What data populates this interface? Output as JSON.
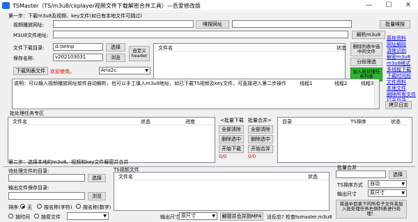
{
  "window": {
    "title": "TSMaster（TS/m3u8/ckplayer视频文件下载解密合并工具）—吾爱修改版"
  },
  "step1": {
    "header": "第一步：下载m3u8及视频、key文件(如已有本地文件可跳过)",
    "video_url_label": "视频播放网址:",
    "video_url_value": "",
    "sniff_button": "嗅探网址",
    "batch_sniff_button": "批量嗅探",
    "m3u8_addr_label": "M3U8文件地址:",
    "m3u8_addr_value": "",
    "parse_m3u8_button": "解析m3u8",
    "dir_label": "文件下载目录:",
    "dir_value": "d:\\temp",
    "choose_button": "选择",
    "custom_header_button": "自定义header",
    "save_name_label": "保存名称:",
    "save_name_value": "v20210303​1",
    "browse_button": "浏览",
    "file_list_header": {
      "name": "文件名",
      "status": "状态"
    },
    "delete_selected_button": "删除列表中选中的文件",
    "segment_filter_button": "分段筛选",
    "add_batch_button": "加入批处理任务列表",
    "download_list_button": "下载列表文件",
    "welcome_text": "欢迎使用。",
    "aria2c_value": "Aria2c",
    "info_text": "说明：可以输入视频播放网址软件自动解析，也可以手工填入m3u8地址，如已下载TS视频及key文件，可直接进入第二步操作。",
    "thread1": "线程1",
    "thread2": "线程2",
    "thread3": "线程3",
    "copy_log_button": "拷贝日志",
    "links": [
      "荔枝资料",
      "网址解码",
      "清晰识别",
      "解密m3u8",
      "m3u8格式",
      "多线程下载",
      "下载时间段",
      "文件资料",
      "本地文件",
      "删除所有文件",
      "打开目录"
    ]
  },
  "batch": {
    "header": "批处理任务专区",
    "columns": {
      "name": "文件名",
      "status": "状态",
      "progress": "进度"
    },
    "batch_download_label": "<批量下载",
    "batch_merge_label": "批量合并>",
    "clear_all_1": "全部清除",
    "delete_selected_1": "删除选中",
    "start_download": "开始下载",
    "counter_1": "0/0",
    "clear_all_2": "全部清除",
    "delete_selected_2": "删除选中",
    "start_merge": "开始合并",
    "counter_2": "0/0",
    "right_columns": {
      "dir": "目录",
      "ts_order": "TS排序",
      "status": "状态"
    }
  },
  "step2": {
    "header": "第二步：选择本地的m3u8、视频和key文件解密并合并",
    "pending_dir_label": "待处理文件的目录:",
    "pending_dir_value": "",
    "choose_button": "选择",
    "output_dir_label": "输出文件保存目录:",
    "output_dir_value": "",
    "browse_button": "浏览",
    "ts_file_label": "TS视频文件",
    "ts_columns": {
      "name": "文件名",
      "status": "状态"
    },
    "sort_label": "排序:",
    "sort_options": [
      "无",
      "按名称(字符)",
      "按名称(数字)"
    ],
    "order_options": [
      "按时间",
      "按原文件"
    ],
    "output_size_label": "输出尺寸",
    "output_size_value": "原尺寸",
    "decrypt_merge_button": "解密并合并到MP4",
    "no_response_text": "没反应? 检查tsmaster.m3u8"
  },
  "batch_merge": {
    "header": "批量合并",
    "dir_value": "",
    "choose_button": "选择",
    "ts_order_label": "TS排序方式",
    "ts_order_value": "自动",
    "output_size_label": "输出尺寸",
    "output_size_value": "原尺寸",
    "action_button": "将选中目录下的所有子文件夹加入批处理任务右侧列表进行处理！"
  }
}
